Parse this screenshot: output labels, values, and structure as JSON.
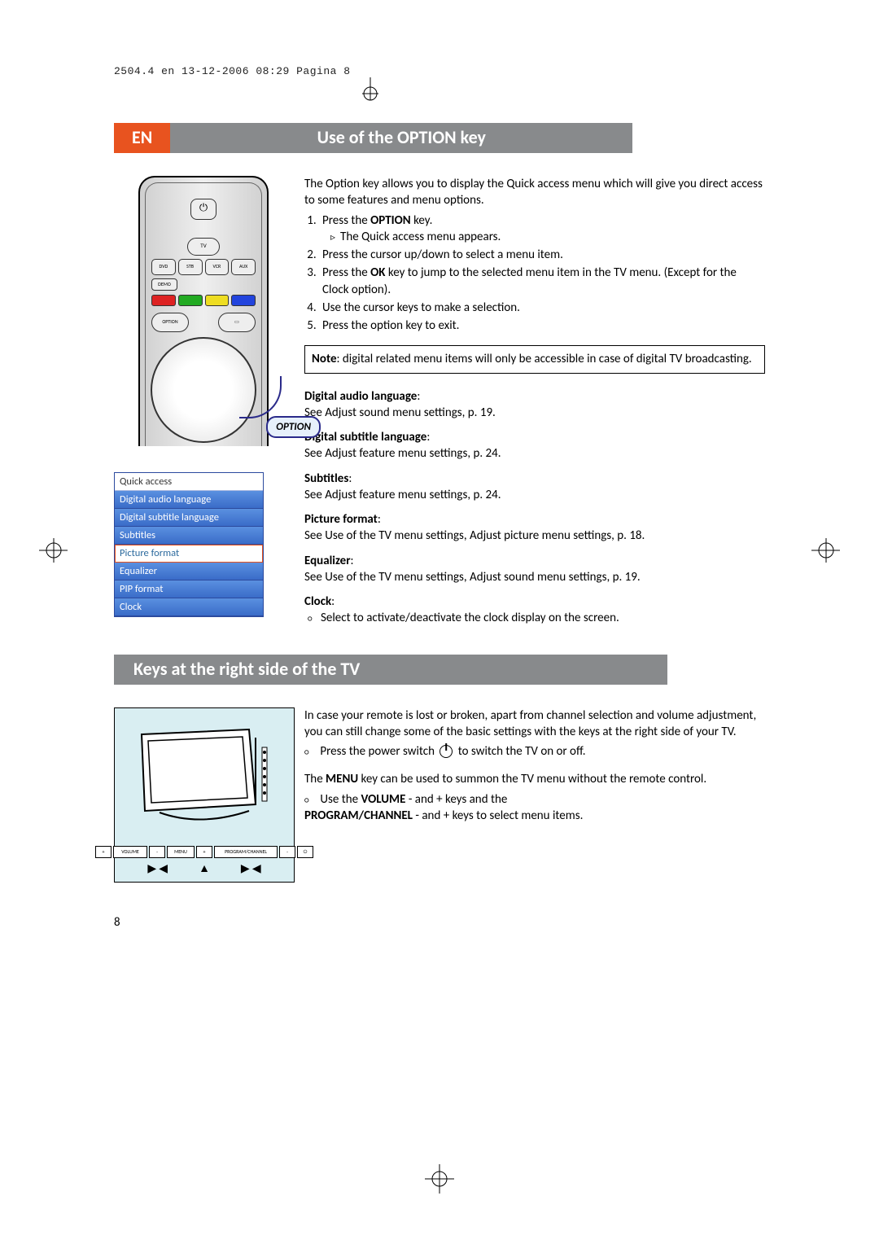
{
  "meta": {
    "header_line": "2504.4 en  13-12-2006  08:29  Pagina 8",
    "lang_badge": "EN",
    "page_number": "8"
  },
  "section1": {
    "title": "Use of the OPTION key",
    "intro": "The Option key allows you to display the Quick access menu which will give you direct access to some features and menu options.",
    "steps": [
      {
        "pre": "Press the ",
        "bold": "OPTION",
        "post": " key.",
        "sub": "The Quick access menu appears."
      },
      {
        "text": "Press the cursor up/down to select a menu item."
      },
      {
        "pre": "Press the ",
        "bold": "OK",
        "post": " key to jump to the selected menu item in the TV menu. (Except for the Clock option)."
      },
      {
        "text": "Use the cursor keys to make a selection."
      },
      {
        "text": "Press the option key to exit."
      }
    ],
    "note_label": "Note",
    "note_text": ": digital related menu items will only be accessible in case of digital TV broadcasting.",
    "defs": [
      {
        "title": "Digital audio language",
        "body": "See Adjust sound menu settings, p. 19."
      },
      {
        "title": "Digital subtitle language",
        "body": "See Adjust feature menu settings, p. 24."
      },
      {
        "title": "Subtitles",
        "body": "See Adjust feature menu settings, p. 24."
      },
      {
        "title": "Picture format",
        "body": "See Use of the TV menu settings, Adjust picture menu settings, p. 18."
      },
      {
        "title": "Equalizer",
        "body": "See Use of the TV menu settings, Adjust sound menu settings, p. 19."
      },
      {
        "title": "Clock",
        "body_bullet": "Select to activate/deactivate the clock display on the screen."
      }
    ]
  },
  "remote": {
    "tv_label": "TV",
    "sources": [
      "DVD",
      "STB",
      "VCR",
      "AUX"
    ],
    "demo_label": "DEMO",
    "option_label": "OPTION",
    "callout": "OPTION"
  },
  "quick_access": {
    "title": "Quick access",
    "items": [
      {
        "label": "Digital audio language",
        "selected": false
      },
      {
        "label": "Digital subtitle language",
        "selected": false
      },
      {
        "label": "Subtitles",
        "selected": false
      },
      {
        "label": "Picture format",
        "selected": true
      },
      {
        "label": "Equalizer",
        "selected": false
      },
      {
        "label": "PIP format",
        "selected": false
      },
      {
        "label": "Clock",
        "selected": false
      }
    ]
  },
  "section2": {
    "title": "Keys at the right side of the TV",
    "intro": "In case your remote is lost or broken, apart from channel selection and volume adjustment, you can still change some of the basic settings with the keys at the right side of your TV.",
    "press_power": "Press the power switch ",
    "press_power_2": " to switch the TV on or off.",
    "menu_sentence_pre": "The ",
    "menu_bold": "MENU",
    "menu_sentence_post": " key can be used to summon the TV menu without the remote control.",
    "use_volume_pre": "Use the ",
    "volume_bold": "VOLUME",
    "use_volume_post": " - and + keys and the ",
    "prog_bold": "PROGRAM/CHANNEL",
    "use_volume_post2": " - and +  keys to select menu items."
  },
  "tv_controls": {
    "labels": [
      "+",
      "VOLUME",
      "-",
      "MENU",
      "+",
      "PROGRAM/CHANNEL",
      "-",
      "⏻"
    ]
  }
}
